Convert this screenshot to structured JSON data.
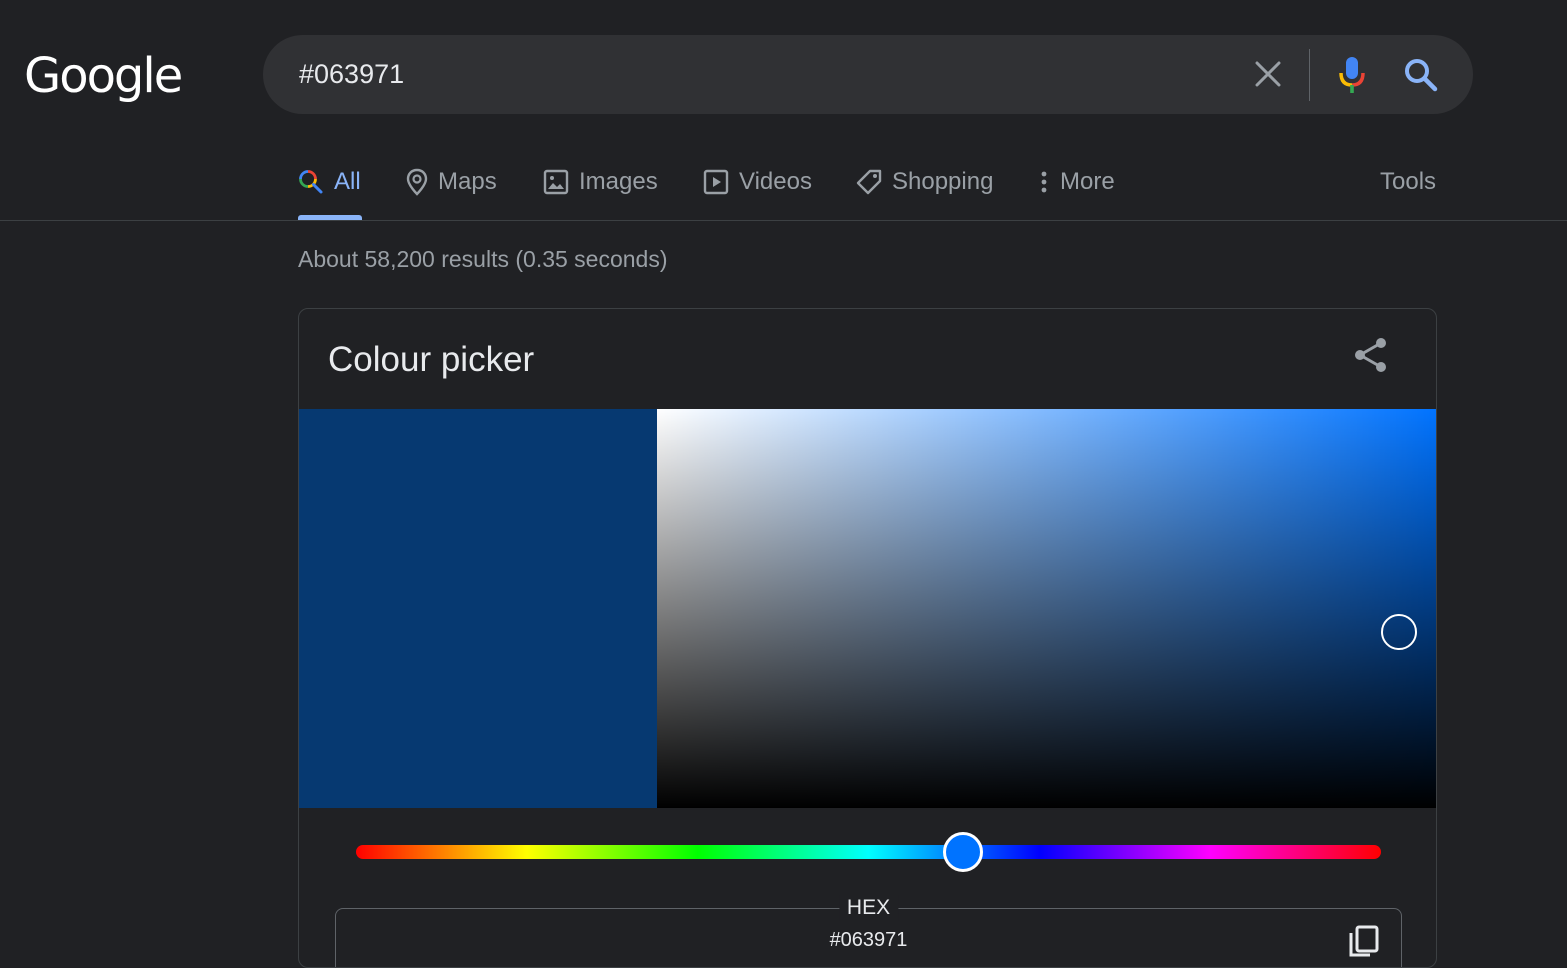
{
  "logo": {
    "text": "Google"
  },
  "search": {
    "query": "#063971"
  },
  "tabs": [
    {
      "label": "All",
      "icon": "search-icon",
      "active": true
    },
    {
      "label": "Maps",
      "icon": "map-pin-icon"
    },
    {
      "label": "Images",
      "icon": "image-icon"
    },
    {
      "label": "Videos",
      "icon": "play-icon"
    },
    {
      "label": "Shopping",
      "icon": "tag-icon"
    },
    {
      "label": "More",
      "icon": "more-vert-icon"
    }
  ],
  "tools_label": "Tools",
  "result_stats": "About 58,200 results (0.35 seconds)",
  "colour_picker": {
    "title": "Colour picker",
    "selected_color": "#063971",
    "hue_color": "#0073ff",
    "hue_fraction": 0.592,
    "saturation": 0.95,
    "value": 0.44,
    "hex_label": "HEX",
    "hex_value": "#063971"
  },
  "colors": {
    "background": "#202124",
    "searchbar": "#303134",
    "accent": "#8ab4f8",
    "muted_text": "#9aa0a6"
  }
}
